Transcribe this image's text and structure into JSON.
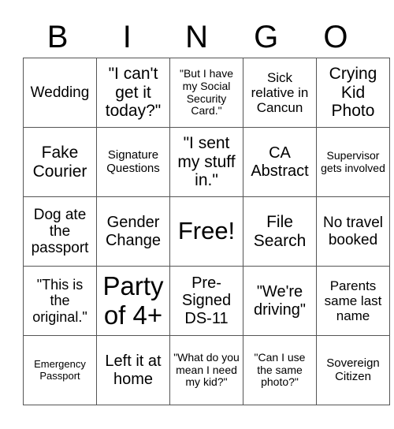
{
  "header": {
    "letters": [
      "B",
      "I",
      "N",
      "G",
      "O"
    ]
  },
  "cells": [
    [
      "Wedding",
      "\"I can't get it today?\"",
      "\"But I have my Social Security Card.\"",
      "Sick relative in Cancun",
      "Crying Kid Photo"
    ],
    [
      "Fake Courier",
      "Signature Questions",
      "\"I sent my stuff in.\"",
      "CA Abstract",
      "Supervisor gets involved"
    ],
    [
      "Dog ate the passport",
      "Gender Change",
      "Free!",
      "File Search",
      "No travel booked"
    ],
    [
      "\"This is the original.\"",
      "Party of 4+",
      "Pre-Signed DS-11",
      "\"We're driving\"",
      "Parents same last name"
    ],
    [
      "Emergency Passport",
      "Left it at home",
      "\"What do you mean I need my kid?\"",
      "\"Can I use the same photo?\"",
      "Sovereign Citizen"
    ]
  ]
}
